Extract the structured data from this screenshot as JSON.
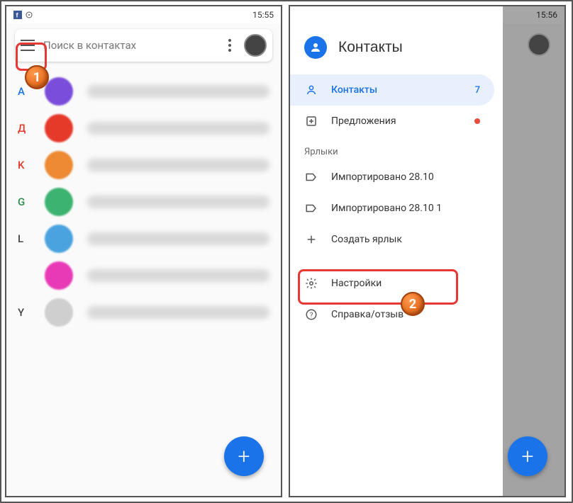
{
  "left": {
    "time": "15:55",
    "search_placeholder": "Поиск в контактах",
    "contacts": [
      {
        "letter": "A",
        "letter_color": "#1a73e8",
        "color": "#7b4ddb"
      },
      {
        "letter": "Д",
        "letter_color": "#e5392a",
        "color": "#e5392a"
      },
      {
        "letter": "K",
        "letter_color": "#e5392a",
        "color": "#ed8a33"
      },
      {
        "letter": "G",
        "letter_color": "#2a8c4a",
        "color": "#3cb371"
      },
      {
        "letter": "L",
        "letter_color": "#444",
        "color": "#4aa3df"
      },
      {
        "letter": "",
        "letter_color": "#444",
        "color": "#e83ab7"
      },
      {
        "letter": "Y",
        "letter_color": "#444",
        "color": "#cfcfcf"
      }
    ]
  },
  "right": {
    "time": "15:56",
    "drawer_title": "Контакты",
    "items_contacts": "Контакты",
    "items_contacts_count": "7",
    "items_suggestions": "Предложения",
    "section_labels": "Ярлыки",
    "label_import1": "Импортировано 28.10",
    "label_import2": "Импортировано 28.10 1",
    "label_create": "Создать ярлык",
    "settings": "Настройки",
    "help": "Справка/отзыв"
  },
  "callouts": {
    "one": "1",
    "two": "2"
  }
}
